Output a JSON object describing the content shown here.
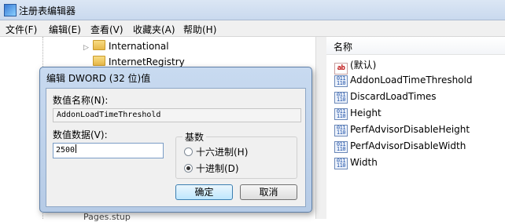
{
  "window": {
    "title": "注册表编辑器"
  },
  "menu": [
    "文件(F)",
    "编辑(E)",
    "查看(V)",
    "收藏夹(A)",
    "帮助(H)"
  ],
  "tree": {
    "nodes": [
      "International",
      "InternetRegistry"
    ],
    "bottom_partial": "Pages.stup"
  },
  "values_pane": {
    "column_header": "名称",
    "items": [
      {
        "name": "(默认)",
        "icon": "string-value-icon"
      },
      {
        "name": "AddonLoadTimeThreshold",
        "icon": "dword-value-icon"
      },
      {
        "name": "DiscardLoadTimes",
        "icon": "dword-value-icon"
      },
      {
        "name": "Height",
        "icon": "dword-value-icon"
      },
      {
        "name": "PerfAdvisorDisableHeight",
        "icon": "dword-value-icon"
      },
      {
        "name": "PerfAdvisorDisableWidth",
        "icon": "dword-value-icon"
      },
      {
        "name": "Width",
        "icon": "dword-value-icon"
      }
    ]
  },
  "dialog": {
    "title": "编辑 DWORD (32 位)值",
    "value_name_label": "数值名称(N):",
    "value_name": "AddonLoadTimeThreshold",
    "value_data_label": "数值数据(V):",
    "value_data": "2500",
    "base_label": "基数",
    "radio_hex": "十六进制(H)",
    "radio_dec": "十进制(D)",
    "selected_base": "decimal",
    "ok": "确定",
    "cancel": "取消"
  }
}
